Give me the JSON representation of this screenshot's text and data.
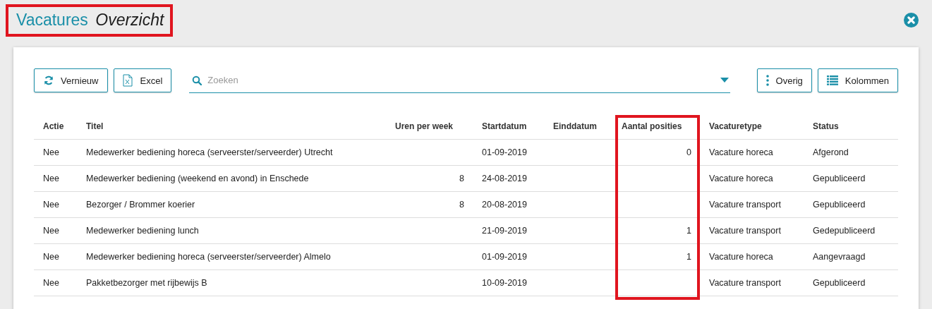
{
  "title": {
    "text": "Vacatures",
    "subtitle": "Overzicht",
    "highlighted": true
  },
  "toolbar": {
    "left_buttons": [
      {
        "label": "Vernieuw",
        "kind": "refresh"
      },
      {
        "label": "Excel",
        "kind": "excel"
      }
    ],
    "search": {
      "placeholder": "Zoeken"
    },
    "right_buttons": [
      {
        "label": "Overig",
        "kind": "more"
      },
      {
        "label": "Kolommen",
        "kind": "columns"
      }
    ]
  },
  "table": {
    "columns": [
      {
        "label": "Actie",
        "highlighted": false
      },
      {
        "label": "Titel",
        "highlighted": false
      },
      {
        "label": "Uren per week",
        "highlighted": false
      },
      {
        "label": "Startdatum",
        "highlighted": false
      },
      {
        "label": "Einddatum",
        "highlighted": false
      },
      {
        "label": "Aantal posities",
        "highlighted": true
      },
      {
        "label": "Vacaturetype",
        "highlighted": false
      },
      {
        "label": "Status",
        "highlighted": false
      }
    ],
    "rows": [
      [
        "Nee",
        "Medewerker bediening horeca (serveerster/serveerder) Utrecht",
        "",
        "01-09-2019",
        "",
        "0",
        "Vacature horeca",
        "Afgerond"
      ],
      [
        "Nee",
        "Medewerker bediening (weekend en avond) in Enschede",
        "8",
        "24-08-2019",
        "",
        "",
        "Vacature horeca",
        "Gepubliceerd"
      ],
      [
        "Nee",
        "Bezorger / Brommer koerier",
        "8",
        "20-08-2019",
        "",
        "",
        "Vacature transport",
        "Gepubliceerd"
      ],
      [
        "Nee",
        "Medewerker bediening lunch",
        "",
        "21-09-2019",
        "",
        "1",
        "Vacature transport",
        "Gedepubliceerd"
      ],
      [
        "Nee",
        "Medewerker bediening horeca (serveerster/serveerder) Almelo",
        "",
        "01-09-2019",
        "",
        "1",
        "Vacature horeca",
        "Aangevraagd"
      ],
      [
        "Nee",
        "Pakketbezorger met rijbewijs B",
        "",
        "10-09-2019",
        "",
        "",
        "Vacature transport",
        "Gepubliceerd"
      ]
    ]
  }
}
